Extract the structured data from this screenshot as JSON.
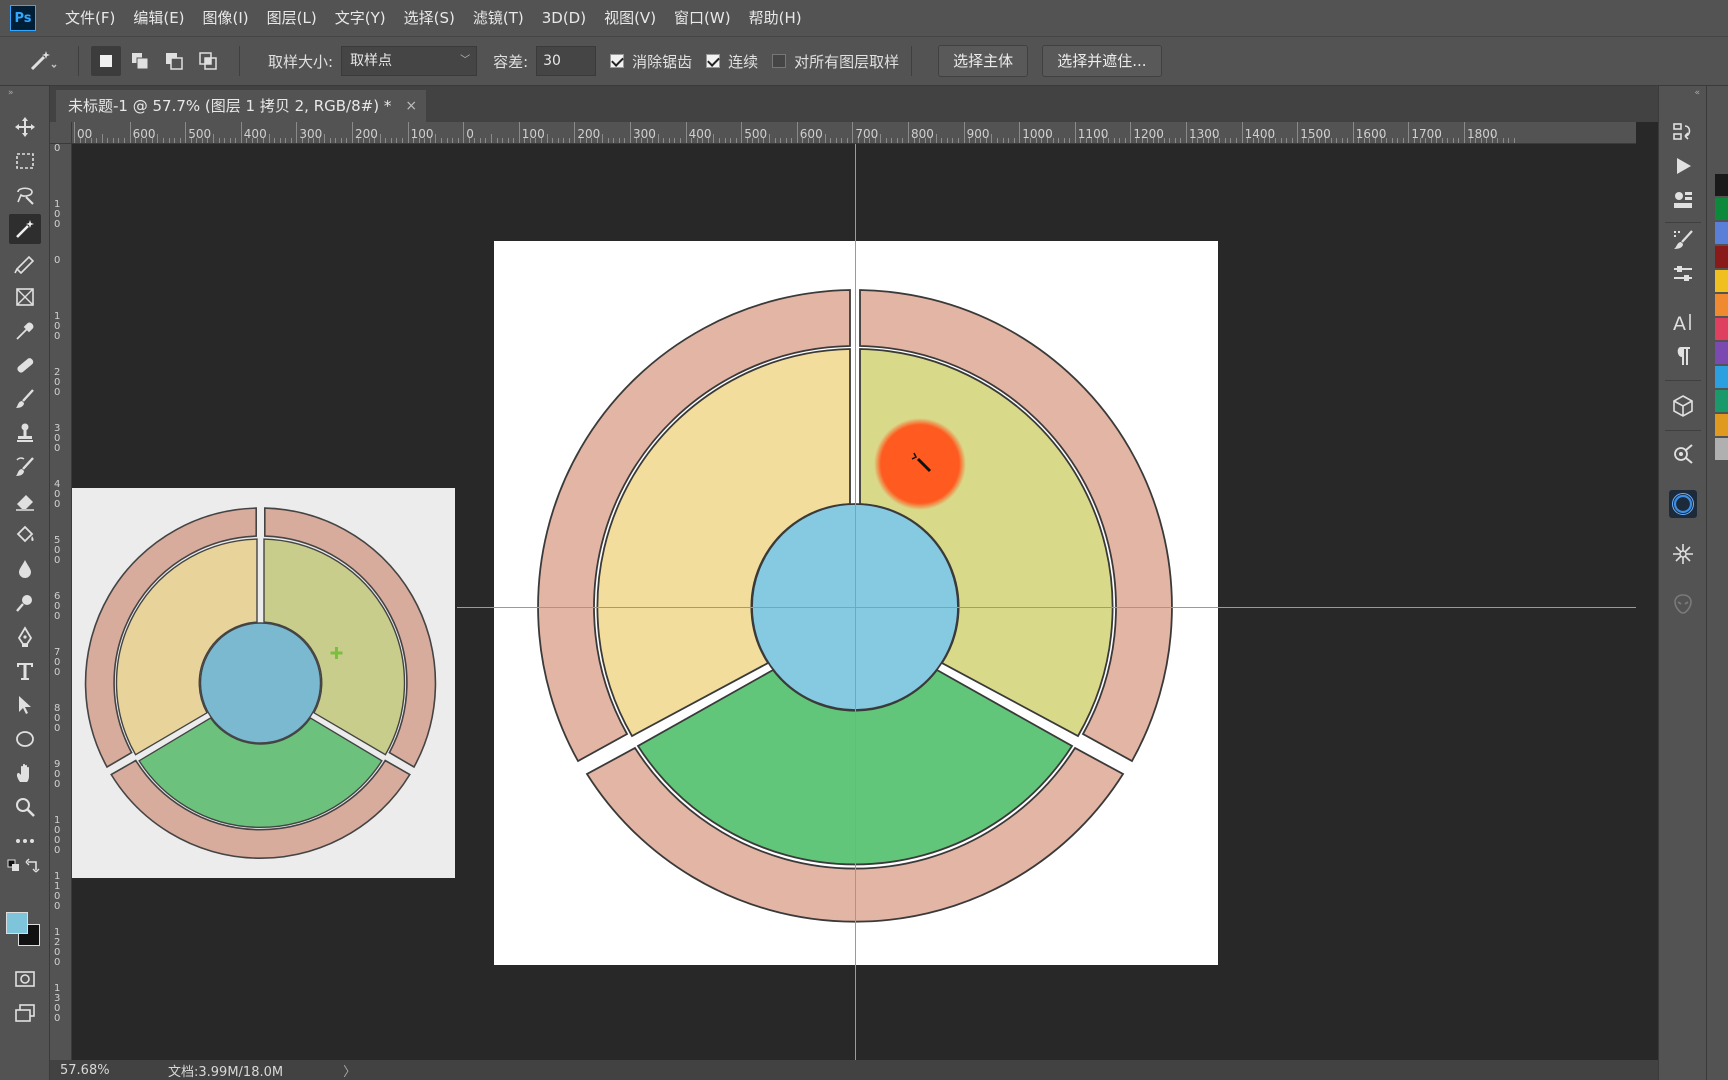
{
  "app": {
    "logo": "Ps"
  },
  "menu": [
    "文件(F)",
    "编辑(E)",
    "图像(I)",
    "图层(L)",
    "文字(Y)",
    "选择(S)",
    "滤镜(T)",
    "3D(D)",
    "视图(V)",
    "窗口(W)",
    "帮助(H)"
  ],
  "options": {
    "sample_size_label": "取样大小:",
    "sample_size_value": "取样点",
    "tolerance_label": "容差:",
    "tolerance_value": "30",
    "anti_alias_label": "消除锯齿",
    "anti_alias_checked": true,
    "contiguous_label": "连续",
    "contiguous_checked": true,
    "sample_all_layers_label": "对所有图层取样",
    "sample_all_layers_checked": false,
    "select_subject_label": "选择主体",
    "select_and_mask_label": "选择并遮住..."
  },
  "document": {
    "tab_title": "未标题-1 @ 57.7% (图层 1 拷贝 2, RGB/8#) *",
    "close_symbol": "×"
  },
  "ruler": {
    "horizontal_labels": [
      "00",
      "600",
      "500",
      "400",
      "300",
      "200",
      "100",
      "0",
      "100",
      "200",
      "300",
      "400",
      "500",
      "600",
      "700",
      "800",
      "900",
      "1000",
      "1100",
      "1200",
      "1300",
      "1400",
      "1500",
      "1600",
      "1700",
      "1800"
    ],
    "vertical_labels": [
      "0",
      "100",
      "0",
      "100",
      "200",
      "300",
      "400",
      "500",
      "600",
      "700",
      "800",
      "900",
      "1000",
      "1100",
      "1200",
      "1300"
    ]
  },
  "status": {
    "zoom": "57.68%",
    "doc_size": "文档:3.99M/18.0M",
    "arrow": "〉"
  },
  "colors": {
    "foreground": "#7ec5dc",
    "background": "#111111",
    "guide": "#27c6e6",
    "ring": "#e3b5a4",
    "yellow_segment": "#f2dd9c",
    "olive_segment": "#d9d98a",
    "green_segment": "#62c67a",
    "center_circle": "#86cae2",
    "cursor_highlight": "#ff5a1f",
    "thumbnail_bg": "#ececec",
    "thumbnail_ring": "#d8ac9c",
    "thumbnail_yellow": "#e8d49a",
    "thumbnail_olive": "#c9cd8b",
    "thumbnail_green": "#6cc27c",
    "thumbnail_center": "#7ab9d0",
    "thumbnail_marker": "#7bbf3e"
  },
  "swatches": [
    "#1a1a1a",
    "#0a8a3a",
    "#5a7fd8",
    "#8a1a1a",
    "#f0c020",
    "#f08a30",
    "#e04060",
    "#7a4ab0",
    "#2aa0e0",
    "#1a9a6a",
    "#e09a20",
    "#b0b0b0"
  ]
}
